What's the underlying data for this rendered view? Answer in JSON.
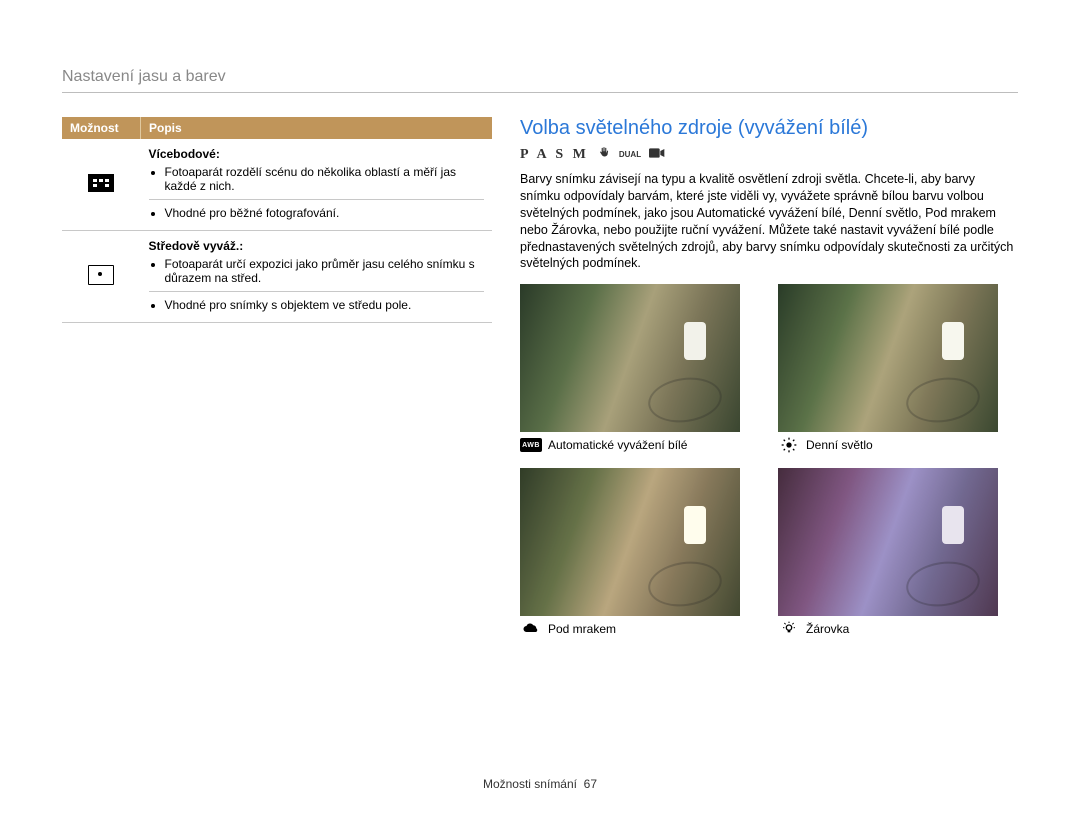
{
  "breadcrumb": "Nastavení jasu a barev",
  "table": {
    "header_option": "Možnost",
    "header_desc": "Popis",
    "rows": [
      {
        "title": "Vícebodové",
        "bul1": "Fotoaparát rozdělí scénu do několika oblastí a měří jas každé z nich.",
        "bul2": "Vhodné pro běžné fotografování."
      },
      {
        "title": "Středově vyváž.",
        "bul1": "Fotoaparát určí expozici jako průměr jasu celého snímku s důrazem na střed.",
        "bul2": "Vhodné pro snímky s objektem ve středu pole."
      }
    ]
  },
  "section_heading": "Volba světelného zdroje (vyvážení bílé)",
  "mode_pasm": "P A S M",
  "mode_dual": "DUAL",
  "body_text": "Barvy snímku závisejí na typu a kvalitě osvětlení zdroji světla. Chcete-li, aby barvy snímku odpovídaly barvám, které jste viděli vy, vyvážete správně bílou barvu volbou světelných podmínek, jako jsou Automatické vyvážení bílé, Denní světlo, Pod mrakem nebo Žárovka, nebo použijte ruční vyvážení. Můžete také nastavit vyvážení bílé podle přednastavených světelných zdrojů, aby barvy snímku odpovídaly skutečnosti za určitých světelných podmínek.",
  "samples": {
    "awb": {
      "icon_text": "AWB",
      "label": "Automatické vyvážení bílé"
    },
    "day": {
      "label": "Denní světlo"
    },
    "cloud": {
      "label": "Pod mrakem"
    },
    "bulb": {
      "label": "Žárovka"
    }
  },
  "footer": {
    "label": "Možnosti snímání",
    "page": "67"
  }
}
